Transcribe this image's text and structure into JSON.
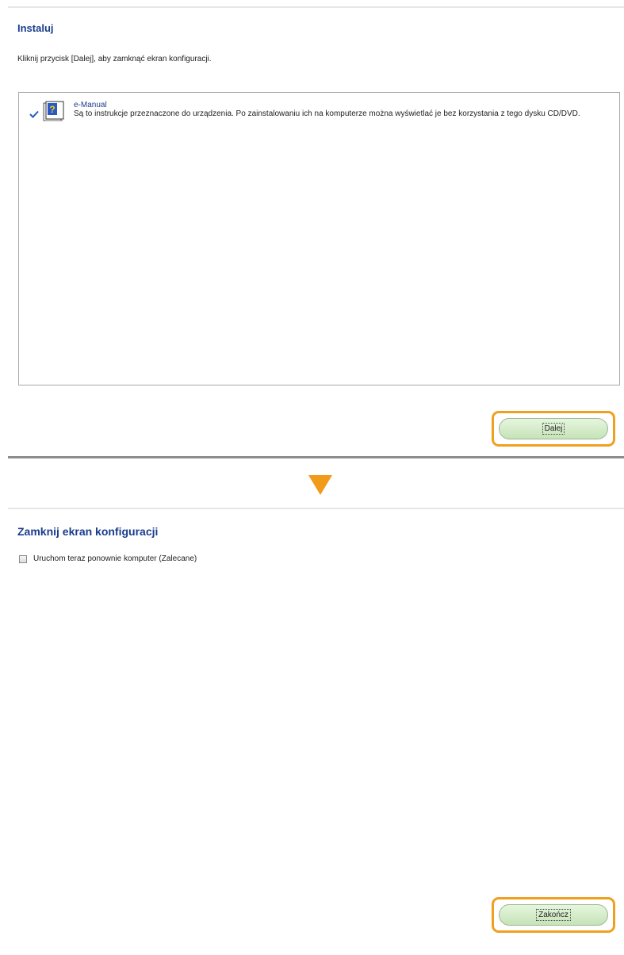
{
  "install_panel": {
    "title": "Instaluj",
    "instruction": "Kliknij przycisk [Dalej], aby zamknąć ekran konfiguracji.",
    "items": [
      {
        "name": "e-Manual",
        "description": "Są to instrukcje przeznaczone do urządzenia. Po zainstalowaniu ich na komputerze można wyświetlać je bez korzystania z tego dysku CD/DVD.",
        "checked": true,
        "icon": "help-book-icon"
      }
    ],
    "next_button_label": "Dalej"
  },
  "close_panel": {
    "title": "Zamknij ekran konfiguracji",
    "restart_checkbox_label": "Uruchom teraz ponownie komputer (Zalecane)",
    "restart_checked": false,
    "finish_button_label": "Zakończ"
  },
  "colors": {
    "title": "#1a3c8c",
    "highlight": "#f0a020",
    "arrow": "#f29a1a",
    "button": "#c5e3b8"
  }
}
